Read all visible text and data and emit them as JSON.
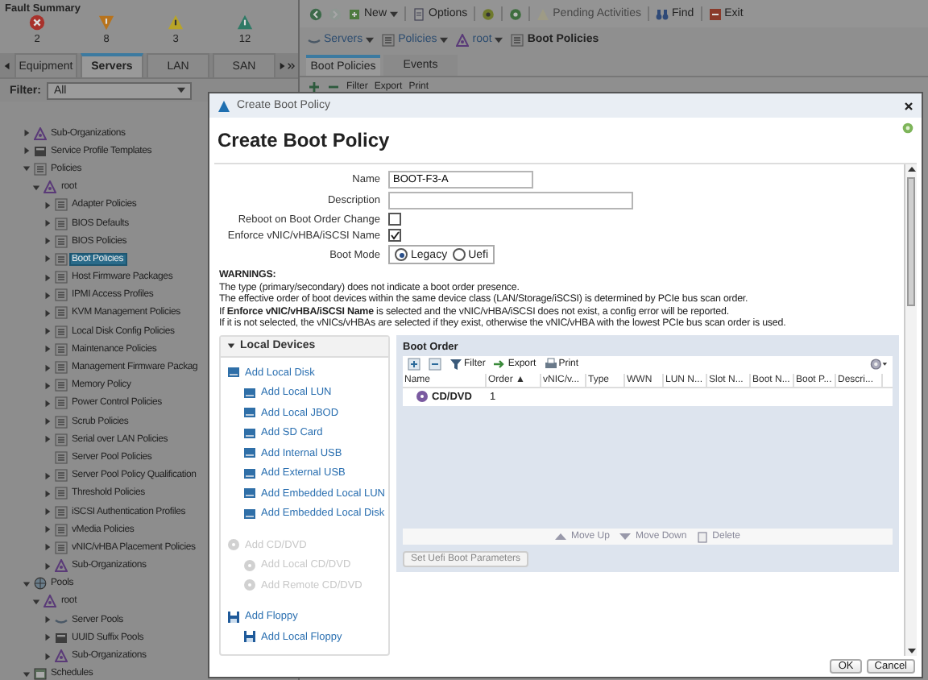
{
  "fault_summary": {
    "title": "Fault Summary",
    "faults": [
      {
        "kind": "critical",
        "count": "2"
      },
      {
        "kind": "major",
        "count": "8"
      },
      {
        "kind": "minor",
        "count": "3"
      },
      {
        "kind": "warning",
        "count": "12"
      }
    ]
  },
  "nav_tabs": [
    {
      "label": "Equipment",
      "selected": false
    },
    {
      "label": "Servers",
      "selected": true
    },
    {
      "label": "LAN",
      "selected": false
    },
    {
      "label": "SAN",
      "selected": false
    }
  ],
  "filter": {
    "label": "Filter:",
    "value": "All"
  },
  "tree": [
    {
      "label": "Sub-Organizations",
      "kind": "org",
      "selected": false,
      "expanded": false
    },
    {
      "label": "Service Profile Templates",
      "kind": "template",
      "selected": false,
      "expanded": false
    },
    {
      "label": "Policies",
      "kind": "policy",
      "selected": false,
      "expanded": true,
      "children": [
        {
          "label": "root",
          "kind": "org",
          "selected": false,
          "expanded": true,
          "children": [
            {
              "label": "Adapter Policies",
              "kind": "policy",
              "selected": false,
              "expanded": false
            },
            {
              "label": "BIOS Defaults",
              "kind": "policy",
              "selected": false,
              "expanded": false
            },
            {
              "label": "BIOS Policies",
              "kind": "policy",
              "selected": false,
              "expanded": false
            },
            {
              "label": "Boot Policies",
              "kind": "policy",
              "selected": true,
              "expanded": false
            },
            {
              "label": "Host Firmware Packages",
              "kind": "policy",
              "selected": false,
              "expanded": false
            },
            {
              "label": "IPMI Access Profiles",
              "kind": "policy",
              "selected": false,
              "expanded": false
            },
            {
              "label": "KVM Management Policies",
              "kind": "policy",
              "selected": false,
              "expanded": false
            },
            {
              "label": "Local Disk Config Policies",
              "kind": "policy",
              "selected": false,
              "expanded": false
            },
            {
              "label": "Maintenance Policies",
              "kind": "policy",
              "selected": false,
              "expanded": false
            },
            {
              "label": "Management Firmware Packag",
              "kind": "policy",
              "selected": false,
              "expanded": false
            },
            {
              "label": "Memory Policy",
              "kind": "policy",
              "selected": false,
              "expanded": false
            },
            {
              "label": "Power Control Policies",
              "kind": "policy",
              "selected": false,
              "expanded": false
            },
            {
              "label": "Scrub Policies",
              "kind": "policy",
              "selected": false,
              "expanded": false
            },
            {
              "label": "Serial over LAN Policies",
              "kind": "policy",
              "selected": false,
              "expanded": false
            },
            {
              "label": "Server Pool Policies",
              "kind": "policy",
              "selected": false
            },
            {
              "label": "Server Pool Policy Qualification",
              "kind": "policy",
              "selected": false,
              "expanded": false
            },
            {
              "label": "Threshold Policies",
              "kind": "policy",
              "selected": false,
              "expanded": false
            },
            {
              "label": "iSCSI Authentication Profiles",
              "kind": "policy",
              "selected": false,
              "expanded": false
            },
            {
              "label": "vMedia Policies",
              "kind": "policy",
              "selected": false,
              "expanded": false
            },
            {
              "label": "vNIC/vHBA Placement Policies",
              "kind": "policy",
              "selected": false,
              "expanded": false
            },
            {
              "label": "Sub-Organizations",
              "kind": "org",
              "selected": false,
              "expanded": false
            }
          ]
        }
      ]
    },
    {
      "label": "Pools",
      "kind": "pools",
      "selected": false,
      "expanded": true,
      "children": [
        {
          "label": "root",
          "kind": "org",
          "selected": false,
          "expanded": true,
          "children": [
            {
              "label": "Server Pools",
              "kind": "servers",
              "selected": false,
              "expanded": false
            },
            {
              "label": "UUID Suffix Pools",
              "kind": "template",
              "selected": false,
              "expanded": false
            },
            {
              "label": "Sub-Organizations",
              "kind": "org",
              "selected": false,
              "expanded": false
            }
          ]
        }
      ]
    },
    {
      "label": "Schedules",
      "kind": "schedule",
      "selected": false,
      "expanded": true
    }
  ],
  "toolbar": [
    {
      "kind": "back",
      "disabled": false
    },
    {
      "kind": "forward",
      "disabled": true
    },
    {
      "kind": "new",
      "label": "New",
      "disabled": false
    },
    {
      "kind": "options",
      "label": "Options",
      "disabled": false
    },
    {
      "kind": "status",
      "disabled": false
    },
    {
      "kind": "info",
      "disabled": false
    },
    {
      "kind": "pending",
      "label": "Pending Activities",
      "disabled": true
    },
    {
      "kind": "find",
      "label": "Find",
      "disabled": false
    },
    {
      "kind": "exit",
      "label": "Exit",
      "disabled": false
    }
  ],
  "breadcrumb": [
    {
      "label": "Servers",
      "kind": "servers",
      "dropdown": true
    },
    {
      "label": "Policies",
      "kind": "policy",
      "dropdown": true
    },
    {
      "label": "root",
      "kind": "org",
      "dropdown": true
    },
    {
      "label": "Boot Policies",
      "kind": "policy",
      "dropdown": false
    }
  ],
  "content_tabs": [
    {
      "label": "Boot Policies",
      "selected": true
    },
    {
      "label": "Events",
      "selected": false
    }
  ],
  "content_toolbar": [
    "Filter",
    "Export",
    "Print"
  ],
  "dialog": {
    "window_title": "Create Boot Policy",
    "heading": "Create Boot Policy",
    "name": {
      "label": "Name",
      "value": "BOOT-F3-A"
    },
    "description": {
      "label": "Description"
    },
    "reboot": {
      "label": "Reboot on Boot Order Change",
      "checked": false
    },
    "enforce": {
      "label": "Enforce vNIC/vHBA/iSCSI Name",
      "checked": true
    },
    "boot_mode": {
      "label": "Boot Mode",
      "options": [
        {
          "label": "Legacy",
          "selected": true
        },
        {
          "label": "Uefi",
          "selected": false
        }
      ]
    },
    "warnings": {
      "title": "WARNINGS:",
      "lines": [
        "The type (primary/secondary) does not indicate a boot order presence.",
        "The effective order of boot devices within the same device class (LAN/Storage/iSCSI) is determined by PCIe bus scan order.",
        "If **Enforce vNIC/vHBA/iSCSI Name** is selected and the vNIC/vHBA/iSCSI does not exist, a config error will be reported.",
        "If it is not selected, the vNICs/vHBAs are selected if they exist, otherwise the vNIC/vHBA with the lowest PCIe bus scan order is used."
      ]
    },
    "local_devices": {
      "title": "Local Devices",
      "expanded": true,
      "groups": [
        {
          "label": "Add Local Disk",
          "kind": "disk",
          "disabled": false,
          "children": [
            {
              "label": "Add Local LUN",
              "disabled": false
            },
            {
              "label": "Add Local JBOD",
              "disabled": false
            },
            {
              "label": "Add SD Card",
              "disabled": false
            },
            {
              "label": "Add Internal USB",
              "disabled": false
            },
            {
              "label": "Add External USB",
              "disabled": false
            },
            {
              "label": "Add Embedded Local LUN",
              "disabled": false
            },
            {
              "label": "Add Embedded Local Disk",
              "disabled": false
            }
          ]
        },
        {
          "label": "Add CD/DVD",
          "kind": "cd",
          "disabled": true,
          "children": [
            {
              "label": "Add Local CD/DVD",
              "disabled": true
            },
            {
              "label": "Add Remote CD/DVD",
              "disabled": true
            }
          ]
        },
        {
          "label": "Add Floppy",
          "kind": "floppy",
          "disabled": false,
          "children": [
            {
              "label": "Add Local Floppy",
              "disabled": false
            }
          ]
        }
      ]
    },
    "boot_order": {
      "title": "Boot Order",
      "toolbar": [
        "Filter",
        "Export",
        "Print"
      ],
      "columns": [
        "Name",
        "Order ▲",
        "vNIC/v...",
        "Type",
        "WWN",
        "LUN N...",
        "Slot N...",
        "Boot N...",
        "Boot P...",
        "Descri..."
      ],
      "rows": [
        {
          "name": "CD/DVD",
          "order": "1"
        }
      ],
      "actions": [
        {
          "kind": "up",
          "label": "Move Up"
        },
        {
          "kind": "down",
          "label": "Move Down"
        },
        {
          "kind": "delete",
          "label": "Delete"
        }
      ],
      "uefi_button": "Set Uefi Boot Parameters"
    },
    "buttons": [
      "OK",
      "Cancel"
    ]
  }
}
